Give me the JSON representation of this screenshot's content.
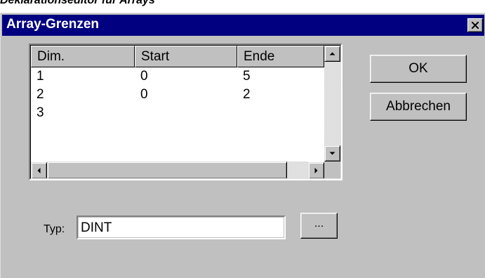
{
  "caption": "Deklarationseditor für Arrays",
  "dialog": {
    "title": "Array-Grenzen",
    "close_icon": "close-icon"
  },
  "listbox": {
    "columns": [
      "Dim.",
      "Start",
      "Ende"
    ],
    "rows": [
      [
        "1",
        "0",
        "5"
      ],
      [
        "2",
        "0",
        "2"
      ],
      [
        "3",
        "",
        ""
      ]
    ]
  },
  "buttons": {
    "ok": "OK",
    "cancel": "Abbrechen",
    "browse": "..."
  },
  "type_field": {
    "label": "Typ:",
    "value": "DINT"
  },
  "colors": {
    "titlebar": "#000080",
    "dialog": "#c0c0c0"
  }
}
